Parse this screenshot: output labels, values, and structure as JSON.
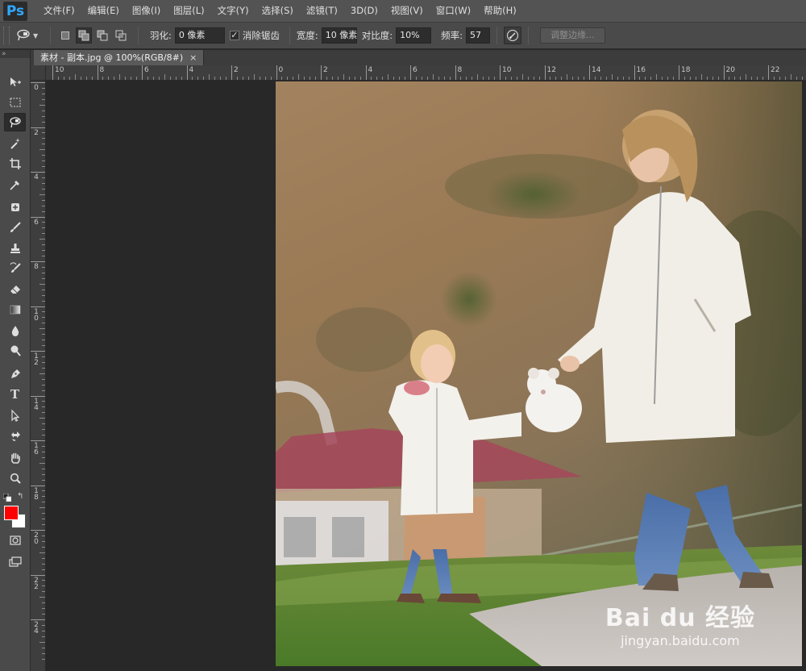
{
  "app": {
    "logo": "Ps"
  },
  "menu": [
    "文件(F)",
    "编辑(E)",
    "图像(I)",
    "图层(L)",
    "文字(Y)",
    "选择(S)",
    "滤镜(T)",
    "3D(D)",
    "视图(V)",
    "窗口(W)",
    "帮助(H)"
  ],
  "options": {
    "feather_label": "羽化:",
    "feather_value": "0 像素",
    "antialias_label": "消除锯齿",
    "antialias_checked": true,
    "width_label": "宽度:",
    "width_value": "10 像素",
    "contrast_label": "对比度:",
    "contrast_value": "10%",
    "frequency_label": "频率:",
    "frequency_value": "57",
    "refine_edge_label": "调整边缘..."
  },
  "document": {
    "tab_title": "素材 - 副本.jpg @ 100%(RGB/8#)",
    "close_glyph": "×"
  },
  "ruler": {
    "h_labels": [
      "10",
      "8",
      "6",
      "4",
      "2",
      "0",
      "2",
      "4",
      "6",
      "8",
      "10",
      "12",
      "14",
      "16",
      "18",
      "20",
      "22"
    ],
    "v_labels": [
      "0",
      "2",
      "4",
      "6",
      "8",
      "10",
      "12",
      "14",
      "16",
      "18",
      "20",
      "22",
      "24"
    ]
  },
  "tools": [
    "move-tool",
    "marquee-tool",
    "lasso-tool",
    "magic-wand-tool",
    "crop-tool",
    "eyedropper-tool",
    "healing-brush-tool",
    "brush-tool",
    "clone-stamp-tool",
    "history-brush-tool",
    "eraser-tool",
    "gradient-tool",
    "blur-tool",
    "dodge-tool",
    "pen-tool",
    "type-tool",
    "path-selection-tool",
    "shape-tool",
    "hand-tool",
    "zoom-tool"
  ],
  "colors": {
    "foreground": "#ff0000",
    "background": "#ffffff"
  },
  "watermark": {
    "main": "Bai du 经验",
    "sub": "jingyan.baidu.com"
  }
}
